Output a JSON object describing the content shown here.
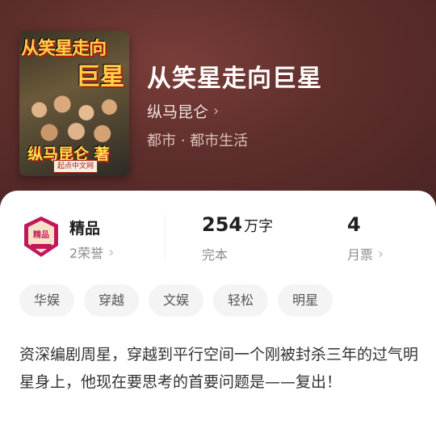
{
  "book": {
    "title": "从笑星走向巨星",
    "author": "纵马昆仑",
    "genre": "都市 · 都市生活",
    "cover": {
      "title_line1": "从笑星走向",
      "title_line2": "巨星",
      "author_line": "纵马昆仑 著",
      "publisher": "起点中文网"
    }
  },
  "stats": {
    "honor": {
      "label": "精品",
      "sub": "2荣誉"
    },
    "words": {
      "value": "254",
      "unit": "万字",
      "sub": "完本"
    },
    "tickets": {
      "value": "4",
      "sub": "月票"
    }
  },
  "tags": [
    "华娱",
    "穿越",
    "文娱",
    "轻松",
    "明星"
  ],
  "description": "资深编剧周星，穿越到平行空间一个刚被封杀三年的过气明星身上，他现在要思考的首要问题是——复出！",
  "icons": {
    "author_chevron": "chevron-right-icon",
    "honor_chevron": "chevron-right-icon",
    "ticket_chevron": "chevron-right-icon",
    "honor_badge": "premium-badge-icon"
  },
  "colors": {
    "header_bg": "#5e2e2c",
    "badge": "#c2185b"
  }
}
